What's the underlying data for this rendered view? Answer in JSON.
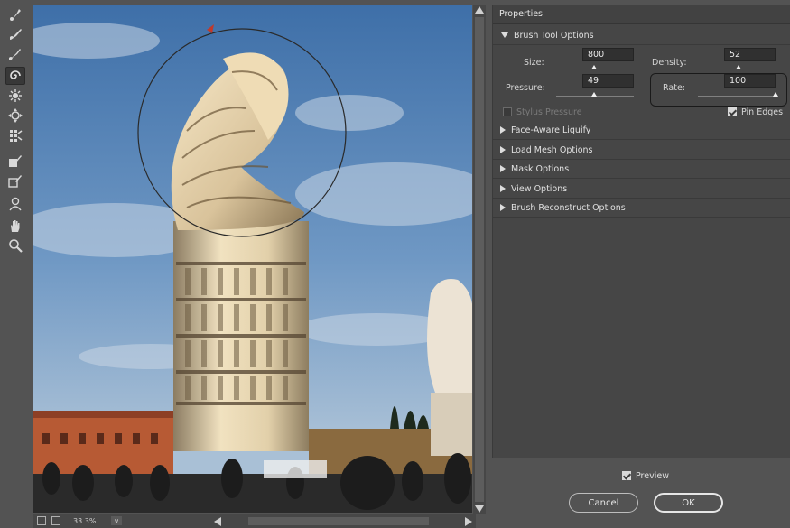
{
  "toolbar": {
    "tools": [
      {
        "name": "forward-warp-icon",
        "active": false
      },
      {
        "name": "reconstruct-icon",
        "active": false
      },
      {
        "name": "smooth-icon",
        "active": false
      },
      {
        "name": "twirl-clockwise-icon",
        "active": true
      },
      {
        "name": "pucker-icon",
        "active": false
      },
      {
        "name": "bloat-icon",
        "active": false
      },
      {
        "name": "push-left-icon",
        "active": false
      },
      {
        "name": "freeze-mask-icon",
        "active": false
      },
      {
        "name": "thaw-mask-icon",
        "active": false
      },
      {
        "name": "face-tool-icon",
        "active": false
      },
      {
        "name": "hand-icon",
        "active": false
      },
      {
        "name": "zoom-icon",
        "active": false
      }
    ]
  },
  "status": {
    "zoom": "33.3%",
    "zoom_dropdown": "∨"
  },
  "properties": {
    "title": "Properties",
    "brush_tool_options": {
      "label": "Brush Tool Options",
      "size_label": "Size:",
      "size_value": "800",
      "size_pct": 0.49,
      "density_label": "Density:",
      "density_value": "52",
      "density_pct": 0.52,
      "pressure_label": "Pressure:",
      "pressure_value": "49",
      "pressure_pct": 0.49,
      "rate_label": "Rate:",
      "rate_value": "100",
      "rate_pct": 1.0,
      "stylus_pressure_label": "Stylus Pressure",
      "stylus_pressure_checked": false,
      "pin_edges_label": "Pin Edges",
      "pin_edges_checked": true
    },
    "sections": [
      "Face-Aware Liquify",
      "Load Mesh Options",
      "Mask Options",
      "View Options",
      "Brush Reconstruct Options"
    ]
  },
  "footer": {
    "preview_label": "Preview",
    "preview_checked": true,
    "cancel_label": "Cancel",
    "ok_label": "OK"
  }
}
